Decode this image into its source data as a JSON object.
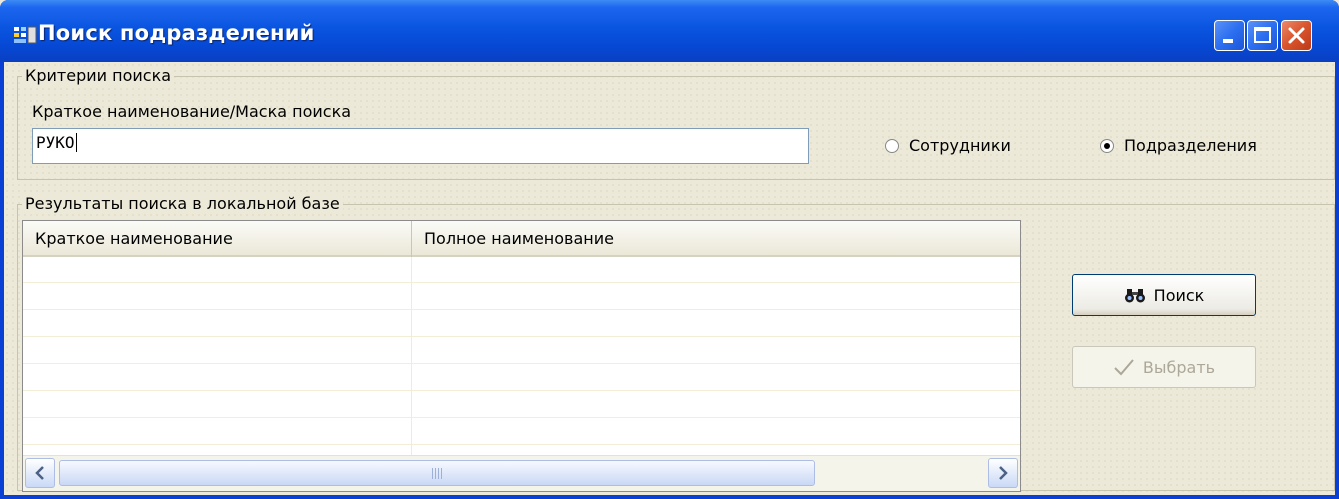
{
  "window": {
    "title": "Поиск подразделений",
    "icon": "app-icon",
    "controls": {
      "minimize": "minimize-icon",
      "maximize": "maximize-icon",
      "close": "close-icon"
    }
  },
  "criteria": {
    "legend": "Критерии поиска",
    "field_label": "Краткое наименование/Маска поиска",
    "field_value": "РУКО",
    "radios": [
      {
        "label": "Сотрудники",
        "checked": false
      },
      {
        "label": "Подразделения",
        "checked": true
      }
    ]
  },
  "results": {
    "legend": "Результаты поиска в локальной базе",
    "columns": [
      "Краткое наименование",
      "Полное наименование"
    ],
    "rows": []
  },
  "buttons": {
    "search_label": "Поиск",
    "search_icon": "binoculars-icon",
    "select_label": "Выбрать",
    "select_icon": "checkmark-icon"
  },
  "colors": {
    "titlebar": "#0a55e0",
    "close_button": "#d7542d",
    "window_bg": "#ece9d8"
  }
}
